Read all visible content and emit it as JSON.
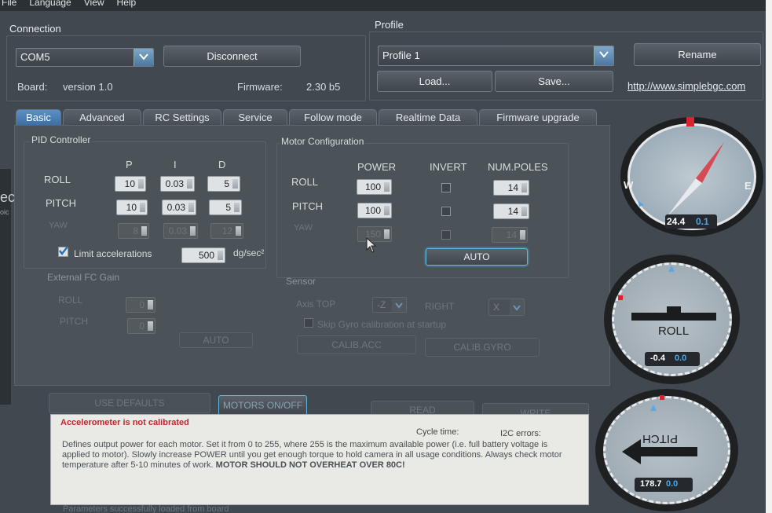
{
  "menu": {
    "file": "File",
    "language": "Language",
    "view": "View",
    "help": "Help"
  },
  "connection": {
    "title": "Connection",
    "port": "COM5",
    "disconnect_label": "Disconnect",
    "board_label": "Board:",
    "board_value": "version 1.0",
    "firmware_label": "Firmware:",
    "firmware_value": "2.30 b5"
  },
  "profile": {
    "title": "Profile",
    "selected": "Profile 1",
    "rename_label": "Rename",
    "load_label": "Load...",
    "save_label": "Save...",
    "website": "http://www.simplebgc.com"
  },
  "tabs": [
    {
      "label": "Basic",
      "active": true
    },
    {
      "label": "Advanced"
    },
    {
      "label": "RC Settings"
    },
    {
      "label": "Service"
    },
    {
      "label": "Follow mode"
    },
    {
      "label": "Realtime Data"
    },
    {
      "label": "Firmware upgrade"
    }
  ],
  "pid": {
    "title": "PID Controller",
    "headers": [
      "P",
      "I",
      "D"
    ],
    "rows": [
      {
        "label": "ROLL",
        "p": "10",
        "i": "0.03",
        "d": "5"
      },
      {
        "label": "PITCH",
        "p": "10",
        "i": "0.03",
        "d": "5"
      },
      {
        "label": "YAW",
        "p": "8",
        "i": "0.03",
        "d": "12"
      }
    ],
    "limit_label": "Limit accelerations",
    "limit_value": "500",
    "limit_unit": "dg/sec²"
  },
  "external_fc": {
    "title": "External FC Gain",
    "roll_label": "ROLL",
    "roll_value": "0",
    "pitch_label": "PITCH",
    "pitch_value": "0",
    "auto_label": "AUTO"
  },
  "motor": {
    "title": "Motor Configuration",
    "headers": [
      "POWER",
      "INVERT",
      "NUM.POLES"
    ],
    "rows": [
      {
        "label": "ROLL",
        "power": "100",
        "poles": "14"
      },
      {
        "label": "PITCH",
        "power": "100",
        "poles": "14"
      },
      {
        "label": "YAW",
        "power": "150",
        "poles": "14"
      }
    ],
    "auto_label": "AUTO"
  },
  "sensor": {
    "title": "Sensor",
    "axis_top_label": "Axis TOP",
    "axis_top_value": "-Z",
    "right_label": "RIGHT",
    "right_value": "X",
    "skip_gyro_label": "Skip Gyro calibration at startup",
    "calib_acc_label": "CALIB.ACC",
    "calib_gyro_label": "CALIB.GYRO"
  },
  "bottom_buttons": {
    "use_defaults": "USE DEFAULTS",
    "motors_onoff": "MOTORS ON/OFF",
    "read": "READ",
    "write": "WRITE"
  },
  "status": {
    "warning": "Accelerometer is not calibrated",
    "cycle_time_label": "Cycle time:",
    "i2c_errors_label": "I2C errors:",
    "help_text": "Defines output power for each motor. Set it from 0 to 255, where 255 is the maximum available power (i.e. full battery voltage is applied to motor). Slowly increase POWER until you get enough torque to hold camera in all usage conditions. Always check motor temperature after 5-10 minutes of work.",
    "help_bold": "MOTOR SHOULD NOT OVERHEAT OVER 80C!",
    "footer": "Parameters successfully loaded from board"
  },
  "gauges": {
    "compass": {
      "west": "W",
      "east": "E",
      "value": "24.4",
      "offset": "0.1"
    },
    "roll": {
      "label": "ROLL",
      "value": "-0.4",
      "offset": "0.0"
    },
    "pitch": {
      "label": "PITCH",
      "value": "178.7",
      "offset": "0.0"
    }
  },
  "left_edge_text": {
    "line1": "ec",
    "line2": "oic"
  },
  "colors": {
    "accent_blue": "#3c6fa6",
    "warning_red": "#c0262d",
    "bg": "#414850"
  }
}
